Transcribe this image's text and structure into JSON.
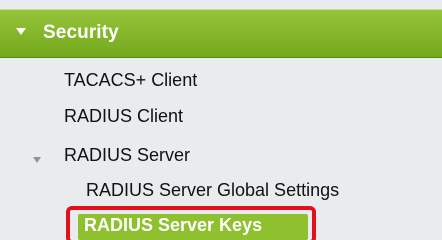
{
  "nav": {
    "section": {
      "label": "Security",
      "expanded": true,
      "toggle_icon": "triangle-down-icon"
    },
    "items": [
      {
        "label": "TACACS+ Client"
      },
      {
        "label": "RADIUS Client"
      },
      {
        "label": "RADIUS Server",
        "expanded": true,
        "toggle_icon": "triangle-down-icon",
        "children": [
          {
            "label": "RADIUS Server Global Settings"
          },
          {
            "label": "RADIUS Server Keys",
            "selected": true
          }
        ]
      }
    ]
  },
  "colors": {
    "header_green": "#7cb225",
    "selected_green": "#8fc02e",
    "highlight_red": "#e3101a",
    "nav_background": "#e9ecee"
  }
}
